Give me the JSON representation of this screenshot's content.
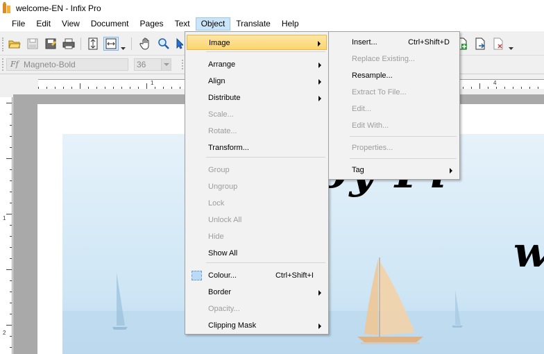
{
  "window": {
    "title": "welcome-EN - Infix Pro"
  },
  "menubar": [
    {
      "label": "File",
      "active": false
    },
    {
      "label": "Edit",
      "active": false
    },
    {
      "label": "View",
      "active": false
    },
    {
      "label": "Document",
      "active": false
    },
    {
      "label": "Pages",
      "active": false
    },
    {
      "label": "Text",
      "active": false
    },
    {
      "label": "Object",
      "active": true
    },
    {
      "label": "Translate",
      "active": false
    },
    {
      "label": "Help",
      "active": false
    }
  ],
  "format_bar": {
    "font": "Magneto-Bold",
    "size": "36"
  },
  "ruler": {
    "h_labels": [
      "1",
      "4"
    ],
    "v_labels": [
      "1",
      "2"
    ]
  },
  "document": {
    "headline_line1": "njoy Pl",
    "headline_line2": "w"
  },
  "object_menu": [
    {
      "label": "Image",
      "shortcut": "",
      "disabled": false,
      "submenu": true,
      "highlight": true
    },
    {
      "label": "Arrange",
      "shortcut": "",
      "disabled": false,
      "submenu": true
    },
    {
      "label": "Align",
      "shortcut": "",
      "disabled": false,
      "submenu": true
    },
    {
      "label": "Distribute",
      "shortcut": "",
      "disabled": false,
      "submenu": true
    },
    {
      "label": "Scale...",
      "shortcut": "",
      "disabled": true,
      "submenu": false
    },
    {
      "label": "Rotate...",
      "shortcut": "",
      "disabled": true,
      "submenu": false
    },
    {
      "label": "Transform...",
      "shortcut": "",
      "disabled": false,
      "submenu": false
    },
    {
      "label": "Group",
      "shortcut": "",
      "disabled": true,
      "submenu": false
    },
    {
      "label": "Ungroup",
      "shortcut": "",
      "disabled": true,
      "submenu": false
    },
    {
      "label": "Lock",
      "shortcut": "",
      "disabled": true,
      "submenu": false
    },
    {
      "label": "Unlock All",
      "shortcut": "",
      "disabled": true,
      "submenu": false
    },
    {
      "label": "Hide",
      "shortcut": "",
      "disabled": true,
      "submenu": false
    },
    {
      "label": "Show All",
      "shortcut": "",
      "disabled": false,
      "submenu": false
    },
    {
      "label": "Colour...",
      "shortcut": "Ctrl+Shift+I",
      "disabled": false,
      "submenu": false
    },
    {
      "label": "Border",
      "shortcut": "",
      "disabled": false,
      "submenu": true
    },
    {
      "label": "Opacity...",
      "shortcut": "",
      "disabled": true,
      "submenu": false
    },
    {
      "label": "Clipping Mask",
      "shortcut": "",
      "disabled": false,
      "submenu": true
    }
  ],
  "image_submenu": [
    {
      "label": "Insert...",
      "shortcut": "Ctrl+Shift+D",
      "disabled": false,
      "submenu": false
    },
    {
      "label": "Replace Existing...",
      "shortcut": "",
      "disabled": true,
      "submenu": false
    },
    {
      "label": "Resample...",
      "shortcut": "",
      "disabled": false,
      "submenu": false
    },
    {
      "label": "Extract To File...",
      "shortcut": "",
      "disabled": true,
      "submenu": false
    },
    {
      "label": "Edit...",
      "shortcut": "",
      "disabled": true,
      "submenu": false
    },
    {
      "label": "Edit With...",
      "shortcut": "",
      "disabled": true,
      "submenu": false
    },
    {
      "label": "Properties...",
      "shortcut": "",
      "disabled": true,
      "submenu": false
    },
    {
      "label": "Tag",
      "shortcut": "",
      "disabled": false,
      "submenu": true
    }
  ]
}
